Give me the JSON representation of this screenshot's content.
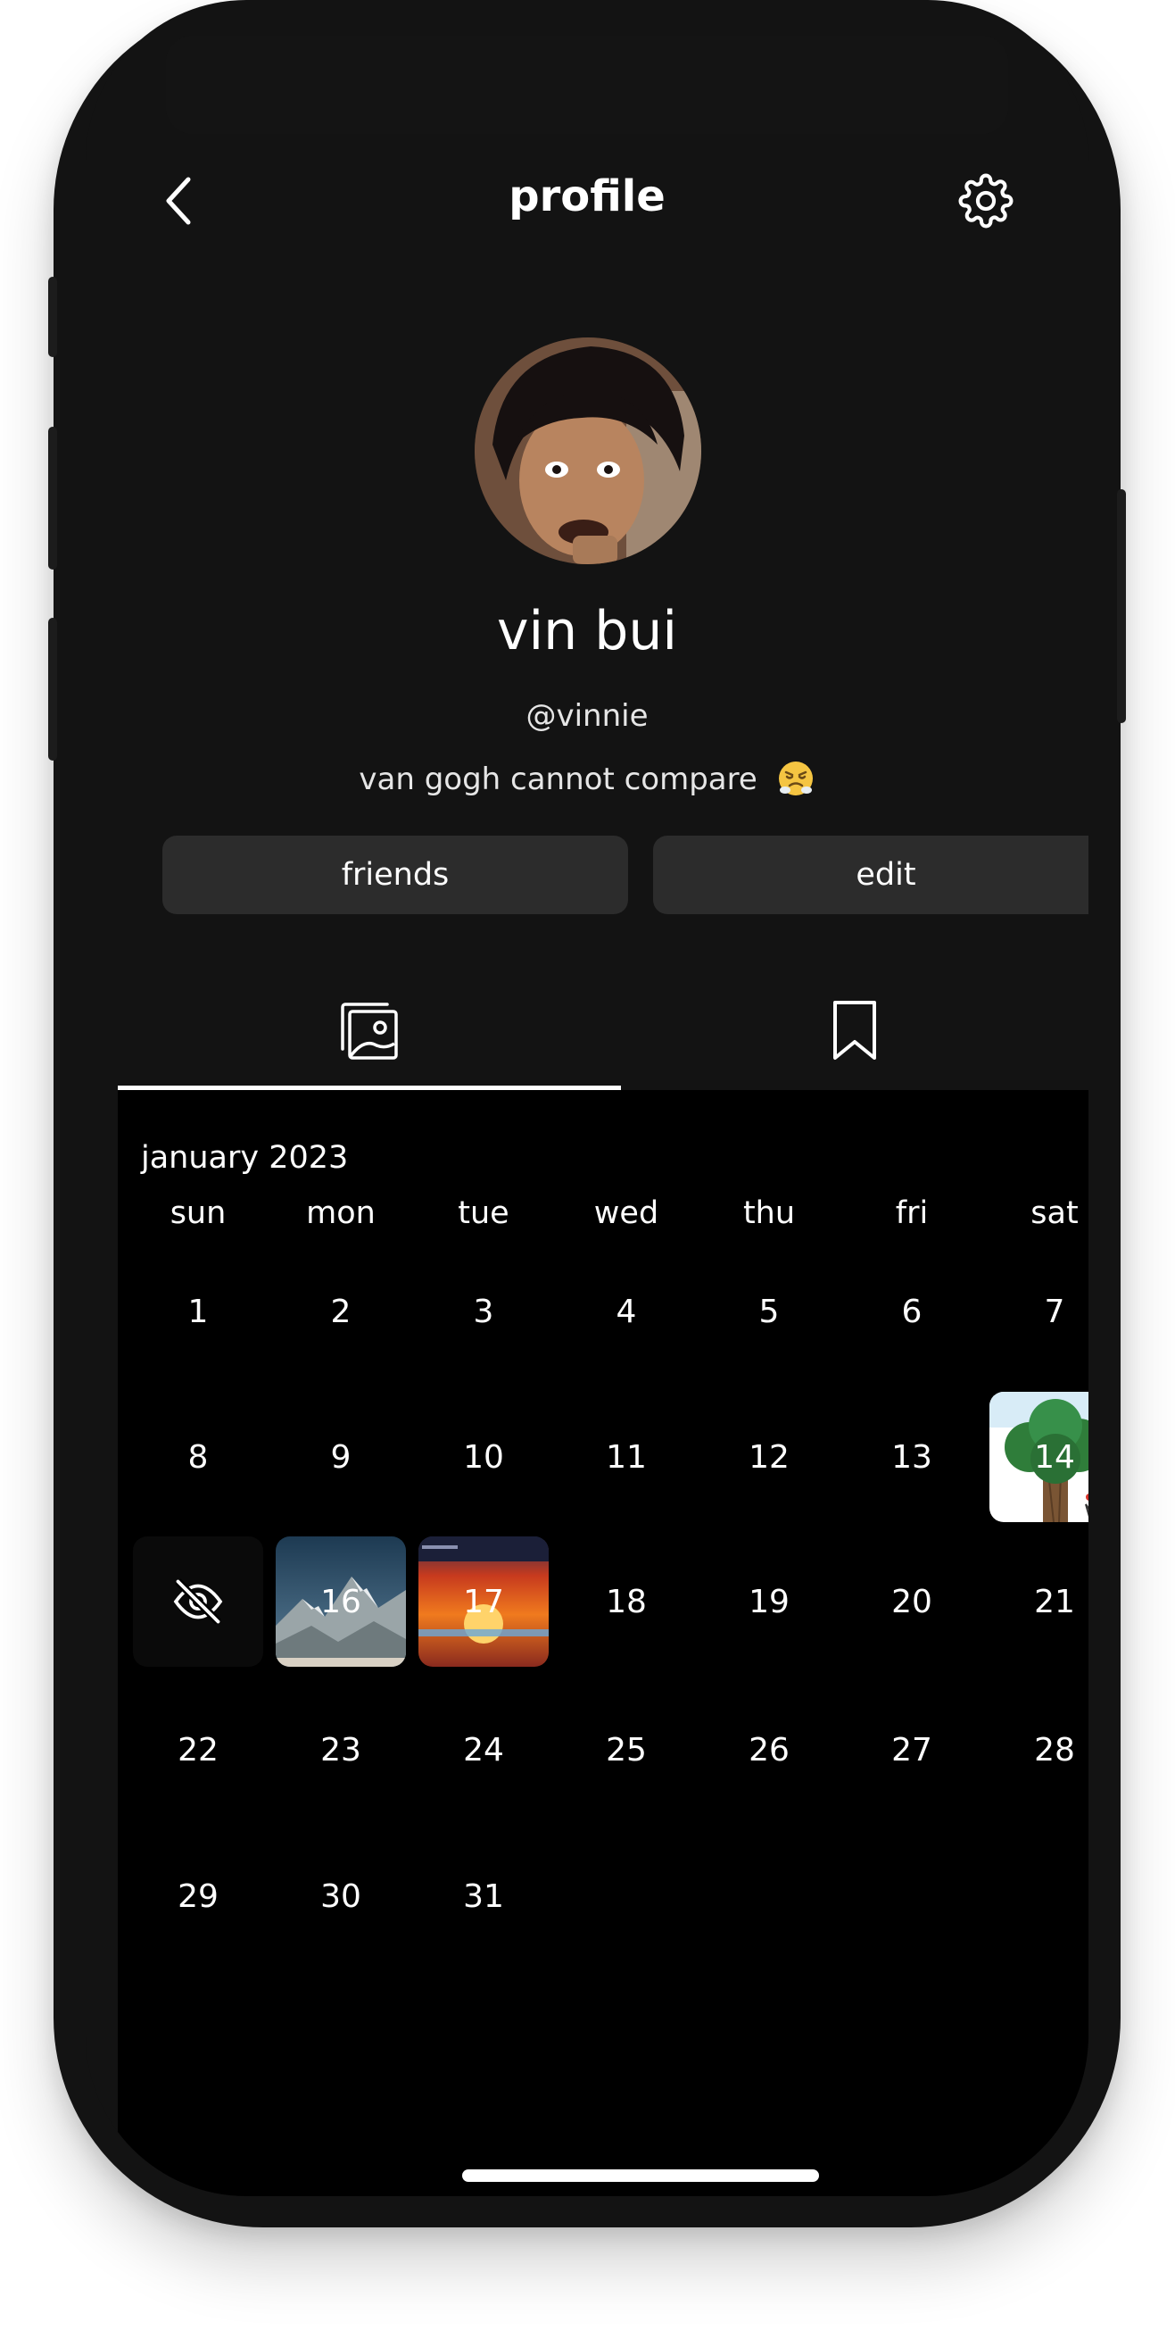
{
  "header": {
    "title": "profile"
  },
  "profile": {
    "name": "vin bui",
    "handle": "@vinnie",
    "bio": "van gogh cannot compare"
  },
  "actions": {
    "friends_label": "friends",
    "edit_label": "edit"
  },
  "tabs": [
    {
      "icon": "photo-gallery-icon",
      "active": true
    },
    {
      "icon": "bookmark-icon",
      "active": false
    }
  ],
  "calendar": {
    "month_label": "january 2023",
    "weekdays": [
      "sun",
      "mon",
      "tue",
      "wed",
      "thu",
      "fri",
      "sat"
    ],
    "weeks": [
      [
        "1",
        "2",
        "3",
        "4",
        "5",
        "6",
        "7"
      ],
      [
        "8",
        "9",
        "10",
        "11",
        "12",
        "13",
        "14"
      ],
      [
        "",
        "16",
        "17",
        "18",
        "19",
        "20",
        "21"
      ],
      [
        "22",
        "23",
        "24",
        "25",
        "26",
        "27",
        "28"
      ],
      [
        "29",
        "30",
        "31",
        "",
        "",
        "",
        ""
      ]
    ],
    "hidden_day_icon": "eye-off-icon",
    "photo_days": [
      "14",
      "16",
      "17"
    ]
  },
  "colors": {
    "background": "#131313",
    "calendar_background": "#000000",
    "button_background": "#2c2c2c",
    "text": "#ffffff"
  }
}
